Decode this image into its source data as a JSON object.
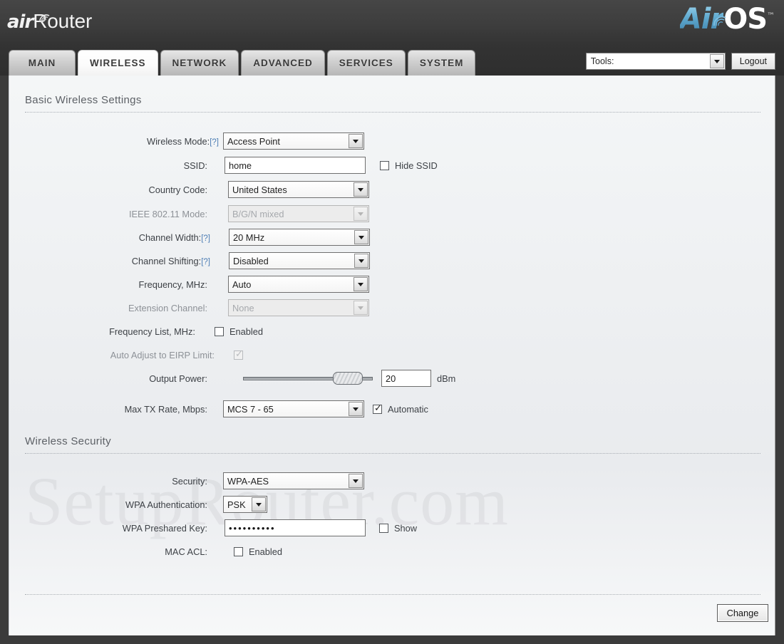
{
  "header": {
    "brand_air": "air",
    "brand_router": "Router",
    "os_air": "Air",
    "os_os": "OS",
    "os_tm": "™"
  },
  "tabs": [
    {
      "label": "MAIN",
      "active": false
    },
    {
      "label": "WIRELESS",
      "active": true
    },
    {
      "label": "NETWORK",
      "active": false
    },
    {
      "label": "ADVANCED",
      "active": false
    },
    {
      "label": "SERVICES",
      "active": false
    },
    {
      "label": "SYSTEM",
      "active": false
    }
  ],
  "toolbar": {
    "tools_label": "Tools:",
    "logout_label": "Logout"
  },
  "watermark": "SetupRouter.com",
  "sections": {
    "basic": {
      "title": "Basic Wireless Settings"
    },
    "security": {
      "title": "Wireless Security"
    }
  },
  "basic_fields": {
    "wireless_mode": {
      "label": "Wireless Mode:",
      "help": "[?]",
      "value": "Access Point"
    },
    "ssid": {
      "label": "SSID:",
      "value": "home",
      "hide_ssid_label": "Hide SSID",
      "hide_ssid_checked": false
    },
    "country_code": {
      "label": "Country Code:",
      "value": "United States"
    },
    "ieee_mode": {
      "label": "IEEE 802.11 Mode:",
      "value": "B/G/N mixed",
      "disabled": true
    },
    "channel_width": {
      "label": "Channel Width:",
      "help": "[?]",
      "value": "20 MHz"
    },
    "channel_shifting": {
      "label": "Channel Shifting:",
      "help": "[?]",
      "value": "Disabled"
    },
    "frequency": {
      "label": "Frequency, MHz:",
      "value": "Auto"
    },
    "extension_channel": {
      "label": "Extension Channel:",
      "value": "None",
      "disabled": true
    },
    "frequency_list": {
      "label": "Frequency List, MHz:",
      "checkbox_label": "Enabled",
      "checked": false
    },
    "eirp": {
      "label": "Auto Adjust to EIRP Limit:",
      "checked": true,
      "disabled": true
    },
    "output_power": {
      "label": "Output Power:",
      "value": "20",
      "unit": "dBm",
      "percent": 90
    },
    "max_tx_rate": {
      "label": "Max TX Rate, Mbps:",
      "value": "MCS 7 - 65",
      "checkbox_label": "Automatic",
      "checked": true
    }
  },
  "security_fields": {
    "security": {
      "label": "Security:",
      "value": "WPA-AES"
    },
    "wpa_auth": {
      "label": "WPA Authentication:",
      "value": "PSK"
    },
    "wpa_key": {
      "label": "WPA Preshared Key:",
      "value": "••••••••••",
      "show_label": "Show",
      "show_checked": false
    },
    "mac_acl": {
      "label": "MAC ACL:",
      "checkbox_label": "Enabled",
      "checked": false
    }
  },
  "footer": {
    "change_label": "Change"
  }
}
